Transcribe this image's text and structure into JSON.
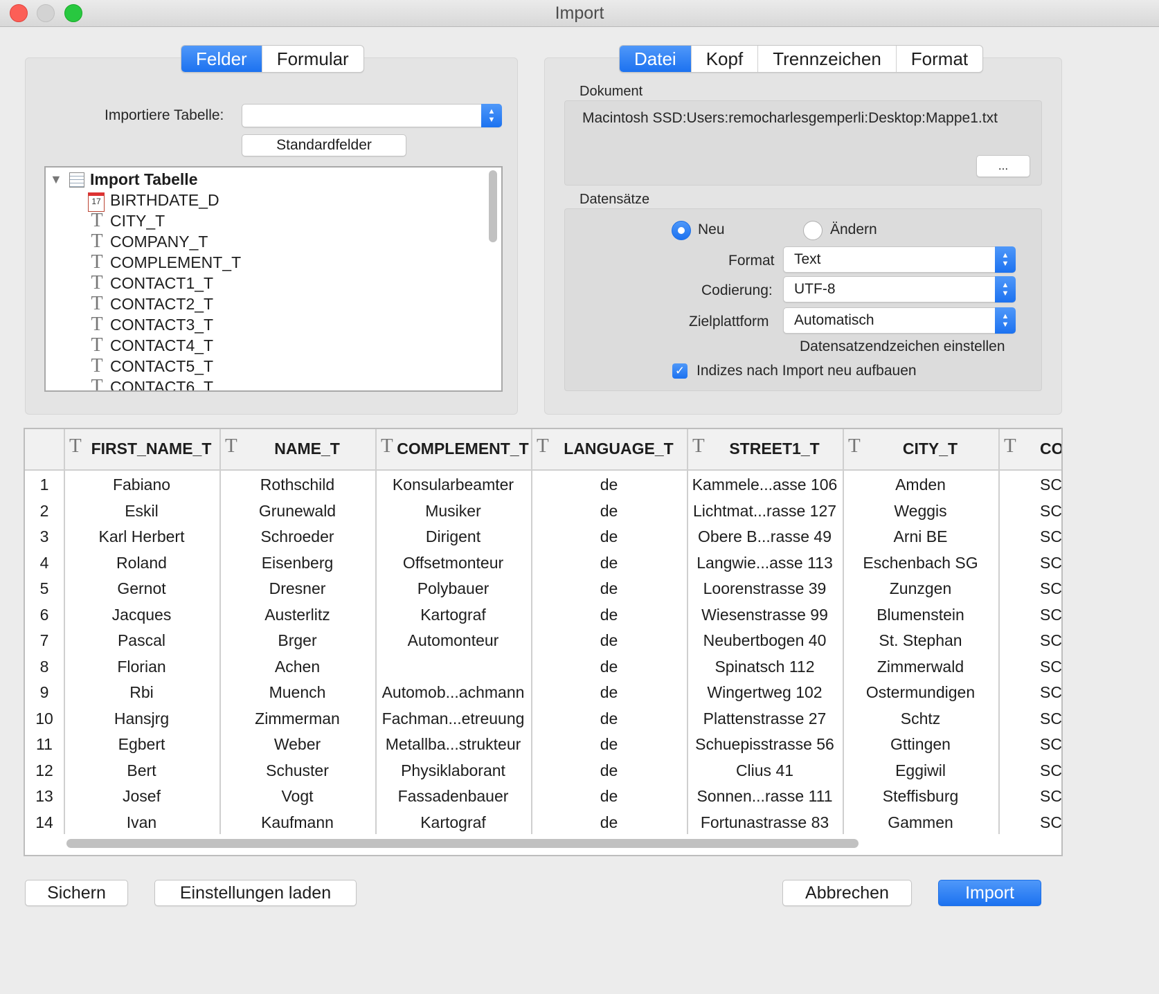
{
  "window": {
    "title": "Import"
  },
  "left": {
    "tabs": [
      "Felder",
      "Formular"
    ],
    "import_table_label": "Importiere Tabelle:",
    "import_table_value": "",
    "standard_button": "Standardfelder",
    "tree_root": "Import Tabelle",
    "fields": [
      {
        "name": "BIRTHDATE_D",
        "icon": "calendar-icon"
      },
      {
        "name": "CITY_T",
        "icon": "text-type-icon"
      },
      {
        "name": "COMPANY_T",
        "icon": "text-type-icon"
      },
      {
        "name": "COMPLEMENT_T",
        "icon": "text-type-icon"
      },
      {
        "name": "CONTACT1_T",
        "icon": "text-type-icon"
      },
      {
        "name": "CONTACT2_T",
        "icon": "text-type-icon"
      },
      {
        "name": "CONTACT3_T",
        "icon": "text-type-icon"
      },
      {
        "name": "CONTACT4_T",
        "icon": "text-type-icon"
      },
      {
        "name": "CONTACT5_T",
        "icon": "text-type-icon"
      },
      {
        "name": "CONTACT6_T",
        "icon": "text-type-icon"
      }
    ]
  },
  "right": {
    "tabs": [
      "Datei",
      "Kopf",
      "Trennzeichen",
      "Format"
    ],
    "document_label": "Dokument",
    "document_path": "Macintosh SSD:Users:remocharlesgemperli:Desktop:Mappe1.txt",
    "browse_button": "...",
    "records_label": "Datensätze",
    "radio_new": "Neu",
    "radio_change": "Ändern",
    "format_label": "Format",
    "format_value": "Text",
    "encoding_label": "Codierung:",
    "encoding_value": "UTF-8",
    "platform_label": "Zielplattform",
    "platform_value": "Automatisch",
    "record_end_link": "Datensatzendzeichen einstellen",
    "rebuild_index_label": "Indizes nach Import neu aufbauen"
  },
  "table": {
    "columns": [
      "FIRST_NAME_T",
      "NAME_T",
      "COMPLEMENT_T",
      "LANGUAGE_T",
      "STREET1_T",
      "CITY_T",
      "CO"
    ],
    "rows": [
      [
        "1",
        "Fabiano",
        "Rothschild",
        "Konsularbeamter",
        "de",
        "Kammele...asse 106",
        "Amden",
        "SC"
      ],
      [
        "2",
        "Eskil",
        "Grunewald",
        "Musiker",
        "de",
        "Lichtmat...rasse 127",
        "Weggis",
        "SC"
      ],
      [
        "3",
        "Karl Herbert",
        "Schroeder",
        "Dirigent",
        "de",
        "Obere B...rasse 49",
        "Arni BE",
        "SC"
      ],
      [
        "4",
        "Roland",
        "Eisenberg",
        "Offsetmonteur",
        "de",
        "Langwie...asse 113",
        "Eschenbach SG",
        "SC"
      ],
      [
        "5",
        "Gernot",
        "Dresner",
        "Polybauer",
        "de",
        "Loorenstrasse 39",
        "Zunzgen",
        "SC"
      ],
      [
        "6",
        "Jacques",
        "Austerlitz",
        "Kartograf",
        "de",
        "Wiesenstrasse 99",
        "Blumenstein",
        "SC"
      ],
      [
        "7",
        "Pascal",
        "Brger",
        "Automonteur",
        "de",
        "Neubertbogen 40",
        "St. Stephan",
        "SC"
      ],
      [
        "8",
        "Florian",
        "Achen",
        "",
        "de",
        "Spinatsch 112",
        "Zimmerwald",
        "SC"
      ],
      [
        "9",
        "Rbi",
        "Muench",
        "Automob...achmann",
        "de",
        "Wingertweg 102",
        "Ostermundigen",
        "SC"
      ],
      [
        "10",
        "Hansjrg",
        "Zimmerman",
        "Fachman...etreuung",
        "de",
        "Plattenstrasse 27",
        "Schtz",
        "SC"
      ],
      [
        "11",
        "Egbert",
        "Weber",
        "Metallba...strukteur",
        "de",
        "Schuepisstrasse 56",
        "Gttingen",
        "SC"
      ],
      [
        "12",
        "Bert",
        "Schuster",
        "Physiklaborant",
        "de",
        "Clius 41",
        "Eggiwil",
        "SC"
      ],
      [
        "13",
        "Josef",
        "Vogt",
        "Fassadenbauer",
        "de",
        "Sonnen...rasse 111",
        "Steffisburg",
        "SC"
      ],
      [
        "14",
        "Ivan",
        "Kaufmann",
        "Kartograf",
        "de",
        "Fortunastrasse 83",
        "Gammen",
        "SC"
      ]
    ]
  },
  "footer": {
    "save": "Sichern",
    "load_settings": "Einstellungen laden",
    "cancel": "Abbrechen",
    "import": "Import"
  },
  "colors": {
    "accent": "#1c72f0"
  }
}
